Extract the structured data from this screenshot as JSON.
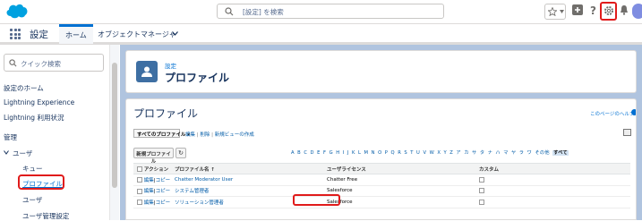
{
  "header": {
    "search_placeholder": "[設定] を検索"
  },
  "app_nav": {
    "app_name": "設定",
    "tabs": [
      {
        "label": "ホーム"
      },
      {
        "label": "オブジェクトマネージャ"
      }
    ]
  },
  "sidebar": {
    "quickfind_placeholder": "クイック検索",
    "items": [
      {
        "label": "設定のホーム"
      },
      {
        "label": "Lightning Experience"
      },
      {
        "label": "Lightning 利用状況"
      },
      {
        "label": "管理"
      },
      {
        "label": "ユーザ"
      },
      {
        "label": "キュー"
      },
      {
        "label": "プロファイル"
      },
      {
        "label": "ユーザ"
      },
      {
        "label": "ユーザ管理設定"
      }
    ]
  },
  "page_header": {
    "breadcrumb": "設定",
    "title": "プロファイル"
  },
  "content": {
    "title": "プロファイル",
    "help_link": "このページのヘルプ",
    "view_select": "すべてのプロファイル",
    "view_links": [
      "編集",
      "削除",
      "新規ビューの作成"
    ],
    "new_button": "新規プロファイル",
    "alphabet": [
      "A",
      "B",
      "C",
      "D",
      "E",
      "F",
      "G",
      "H",
      "I",
      "J",
      "K",
      "L",
      "M",
      "N",
      "O",
      "P",
      "Q",
      "R",
      "S",
      "T",
      "U",
      "V",
      "W",
      "X",
      "Y",
      "Z",
      "ア",
      "カ",
      "サ",
      "タ",
      "ナ",
      "ハ",
      "マ",
      "ヤ",
      "ラ",
      "ワ",
      "その他",
      "すべて"
    ],
    "alphabet_current": "すべて",
    "columns": {
      "action": "アクション",
      "name": "プロファイル名 ↑",
      "license": "ユーザライセンス",
      "custom": "カスタム"
    },
    "row_actions": {
      "edit": "編集",
      "copy": "コピー"
    },
    "rows": [
      {
        "name": "Chatter Moderator User",
        "license": "Chatter Free"
      },
      {
        "name": "システム管理者",
        "license": "Salesforce"
      },
      {
        "name": "ソリューション管理者",
        "license": "Salesforce"
      }
    ]
  }
}
